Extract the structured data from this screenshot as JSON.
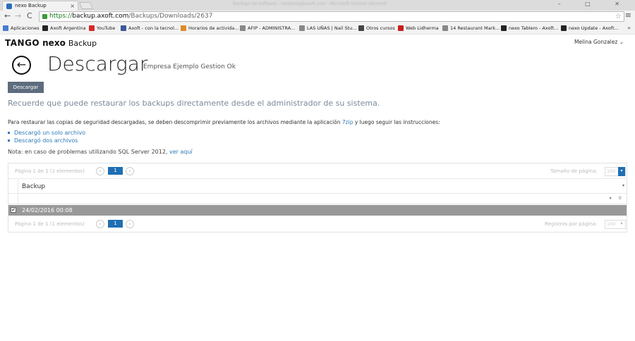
{
  "browser": {
    "tab_title": "nexo Backup",
    "tab_close": "×",
    "window_title": "Backups de software - mhelmsg@axoft.com - Microsoft Outlook (blurred)",
    "window_buttons": "– □ ✕",
    "back": "←",
    "forward": "→",
    "reload": "C",
    "url_scheme": "https://",
    "url_host": "backup.axoft.com",
    "url_path": "/Backups/Downloads/2637",
    "star": "☆",
    "menu": "≡",
    "bookmarks": [
      {
        "label": "Aplicaciones",
        "color": "#4a7bd0"
      },
      {
        "label": "Axoft Argentina",
        "color": "#222222"
      },
      {
        "label": "YouTube",
        "color": "#d62828"
      },
      {
        "label": "Axoft - con la tecnol...",
        "color": "#3a5a9a"
      },
      {
        "label": "Horarios de activida...",
        "color": "#e08a2a"
      },
      {
        "label": "AFIP - ADMINISTRA...",
        "color": "#888888"
      },
      {
        "label": "LAS UÑAS | Nail Stu...",
        "color": "#888888"
      },
      {
        "label": "Otros cursos",
        "color": "#444444"
      },
      {
        "label": "Web Lidherma",
        "color": "#c81e1e"
      },
      {
        "label": "14 Restaurant Mark...",
        "color": "#888888"
      },
      {
        "label": "nexo Tablero - Axoft...",
        "color": "#222222"
      },
      {
        "label": "nexo Update - Axoft...",
        "color": "#222222"
      }
    ],
    "bookmarks_more": "»"
  },
  "app": {
    "logo_tango": "TANGO",
    "logo_nexo": "nexo",
    "logo_product": "Backup",
    "user_name": "Melina Gonzalez",
    "user_caret": "⌄"
  },
  "page": {
    "back_icon": "←",
    "title": "Descargar",
    "subtitle": "Empresa Ejemplo Gestion Ok",
    "download_button": "Descargar",
    "hint": "Recuerde que puede restaurar los backups directamente desde el administrador de su sistema.",
    "instructions_pre": "Para restaurar las copias de seguridad descargadas, se deben descomprimir previamente los archivos mediante la aplicación ",
    "instructions_link": "7zip",
    "instructions_post": " y luego seguir las instrucciones:",
    "link_single": "Descargó un solo archivo",
    "link_two": "Descargó dos archivos",
    "note_pre": "Nota: en caso de problemas utilizando SQL Server 2012, ",
    "note_link": "ver aquí"
  },
  "grid": {
    "pager_info": "Página 1 de 1 (1 elementos)",
    "prev": "‹",
    "next": "›",
    "current_page": "1",
    "page_size_label": "Tamaño de página:",
    "rows_per_page_label": "Registros por página:",
    "page_size": "100",
    "dropdown_caret": "▾",
    "column_header": "Backup",
    "column_caret": "▾",
    "filter_icons": "▾ ⚲",
    "rows": [
      {
        "checked": "✔",
        "date": "24/02/2016 00:08"
      }
    ]
  }
}
